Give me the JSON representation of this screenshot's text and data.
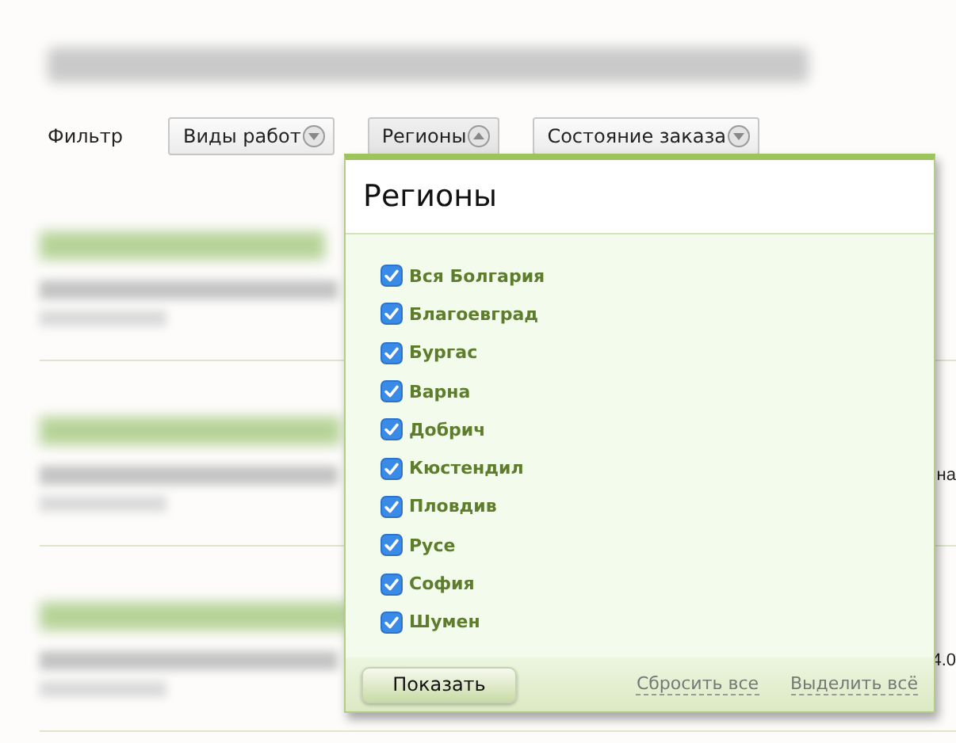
{
  "filter": {
    "label": "Фильтр",
    "buttons": [
      {
        "label": "Виды работ",
        "expanded": false
      },
      {
        "label": "Регионы",
        "expanded": true
      },
      {
        "label": "Состояние заказа",
        "expanded": false
      }
    ]
  },
  "listings": [
    {
      "description_end": "на"
    },
    {
      "description_end": "4.0"
    }
  ],
  "popup": {
    "title": "Регионы",
    "items": [
      {
        "label": "Вся Болгария",
        "checked": true
      },
      {
        "label": "Благоевград",
        "checked": true
      },
      {
        "label": "Бургас",
        "checked": true
      },
      {
        "label": "Варна",
        "checked": true
      },
      {
        "label": "Добрич",
        "checked": true
      },
      {
        "label": "Кюстендил",
        "checked": true
      },
      {
        "label": "Пловдив",
        "checked": true
      },
      {
        "label": "Русе",
        "checked": true
      },
      {
        "label": "София",
        "checked": true
      },
      {
        "label": "Шумен",
        "checked": true
      }
    ],
    "apply_button": "Показать",
    "reset_link": "Сбросить все",
    "select_all_link": "Выделить всё"
  }
}
